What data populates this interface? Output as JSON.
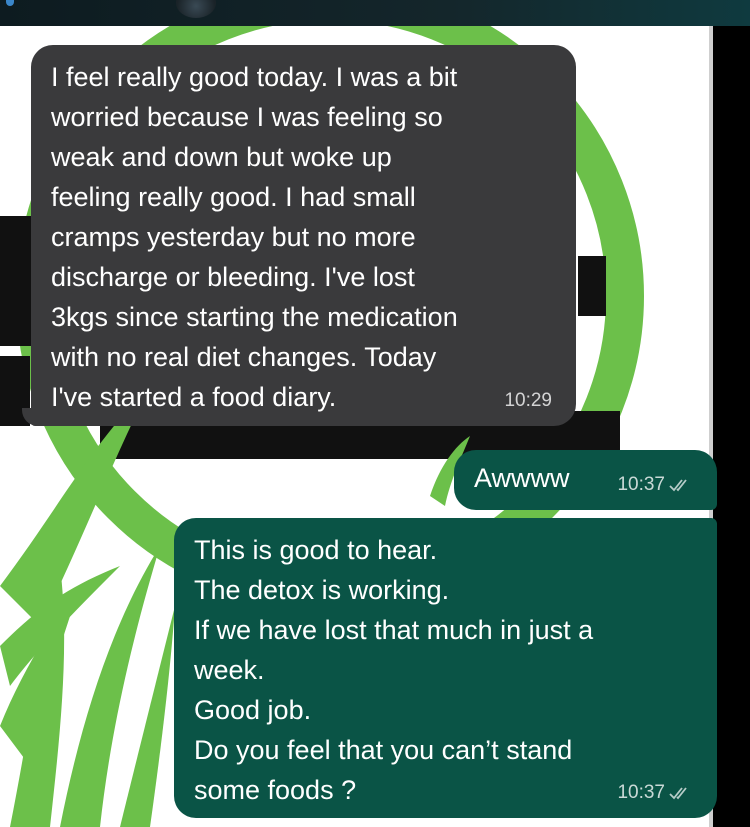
{
  "chat": {
    "messages": [
      {
        "direction": "incoming",
        "text": "I feel really good today. I was a bit\nworried because I was feeling so\nweak and down but woke up\nfeeling really good. I had small\ncramps yesterday but no more\ndischarge or bleeding. I've lost\n3kgs since starting the medication\nwith no real diet changes. Today\nI've started a food diary.",
        "time": "10:29"
      },
      {
        "direction": "outgoing",
        "text": "Awwww",
        "time": "10:37",
        "status_icon": "double-check-icon"
      },
      {
        "direction": "outgoing",
        "text": "This is good to hear.\nThe detox is working.\nIf we have lost that much in just a\nweek.\nGood job.\nDo you feel that you can’t stand\nsome foods ?",
        "time": "10:37",
        "status_icon": "double-check-icon"
      }
    ]
  },
  "colors": {
    "incoming_bubble": "#3a3a3c",
    "outgoing_bubble": "#0a5446",
    "wallpaper_green": "#6cc04a"
  }
}
